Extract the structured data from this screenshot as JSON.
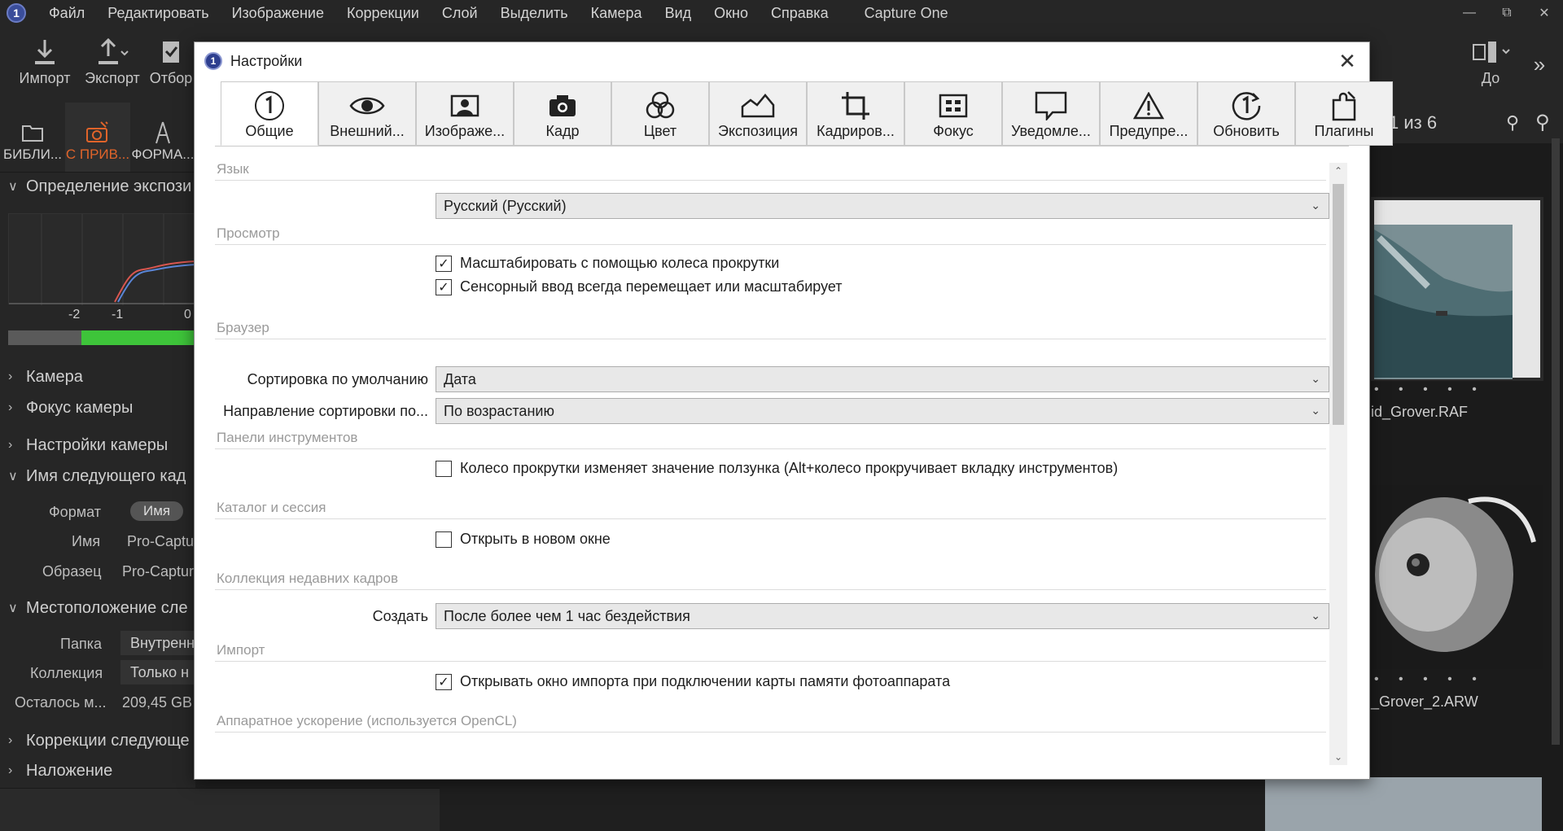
{
  "menubar": {
    "items": [
      "Файл",
      "Редактировать",
      "Изображение",
      "Коррекции",
      "Слой",
      "Выделить",
      "Камера",
      "Вид",
      "Окно",
      "Справка"
    ],
    "app_title": "Capture One",
    "logo": "1"
  },
  "toolbar": {
    "import_label": "Импорт",
    "export_label": "Экспорт",
    "select_label": "Отбор",
    "before_label": "До"
  },
  "left_tabs": [
    {
      "label": "БИБЛИ...",
      "icon": "folder-icon"
    },
    {
      "label": "С ПРИВ...",
      "icon": "camera-tether-icon"
    },
    {
      "label": "ФОРМА...",
      "icon": "compass-icon"
    }
  ],
  "left_panel": {
    "exposure_section": "Определение экспози",
    "scale": [
      "-2",
      "-1",
      "0"
    ],
    "camera": "Камера",
    "camera_focus": "Фокус камеры",
    "camera_settings": "Настройки камеры",
    "next_capture_name": "Имя следующего кад",
    "format_label": "Формат",
    "format_pill": "Имя",
    "name_label": "Имя",
    "name_value": "Pro-Captu",
    "sample_label": "Образец",
    "sample_value": "Pro-Captur",
    "location_section": "Местоположение сле",
    "folder_label": "Папка",
    "folder_value": "Внутренн",
    "collection_label": "Коллекция",
    "collection_value": "Только н",
    "remaining_label": "Осталось м...",
    "remaining_value": "209,45 GB",
    "next_adjustments": "Коррекции следующе",
    "overlay": "Наложение"
  },
  "browser": {
    "counter": "1 из 6",
    "files": [
      "id_Grover.RAF",
      "_Grover_2.ARW"
    ]
  },
  "dialog": {
    "title": "Настройки",
    "tabs": [
      {
        "label": "Общие",
        "icon": "general-icon",
        "active": true
      },
      {
        "label": "Внешний...",
        "icon": "eye-icon",
        "active": false
      },
      {
        "label": "Изображе...",
        "icon": "image-icon",
        "active": false
      },
      {
        "label": "Кадр",
        "icon": "camera-icon",
        "active": false
      },
      {
        "label": "Цвет",
        "icon": "color-circles-icon",
        "active": false
      },
      {
        "label": "Экспозиция",
        "icon": "exposure-icon",
        "active": false
      },
      {
        "label": "Кадриров...",
        "icon": "crop-icon",
        "active": false
      },
      {
        "label": "Фокус",
        "icon": "focus-icon",
        "active": false
      },
      {
        "label": "Уведомле...",
        "icon": "notification-icon",
        "active": false
      },
      {
        "label": "Предупре...",
        "icon": "warning-icon",
        "active": false
      },
      {
        "label": "Обновить",
        "icon": "update-icon",
        "active": false
      },
      {
        "label": "Плагины",
        "icon": "plugin-icon",
        "active": false
      }
    ],
    "sections": {
      "language": {
        "heading": "Язык",
        "value": "Русский (Русский)"
      },
      "view": {
        "heading": "Просмотр",
        "scroll_zoom": {
          "label": "Масштабировать с помощью колеса прокрутки",
          "checked": true
        },
        "touch_input": {
          "label": "Сенсорный ввод всегда перемещает или масштабирует",
          "checked": true
        }
      },
      "browser": {
        "heading": "Браузер",
        "sort_label": "Сортировка по умолчанию",
        "sort_value": "Дата",
        "direction_label": "Направление сортировки по...",
        "direction_value": "По возрастанию"
      },
      "tools": {
        "heading": "Панели инструментов",
        "scroll_slider": {
          "label": "Колесо прокрутки изменяет значение ползунка (Alt+колесо прокручивает вкладку инструментов)",
          "checked": false
        }
      },
      "catalog": {
        "heading": "Каталог и сессия",
        "new_window": {
          "label": "Открыть в новом окне",
          "checked": false
        }
      },
      "recent": {
        "heading": "Коллекция недавних кадров",
        "create_label": "Создать",
        "create_value": "После более чем 1 час бездействия"
      },
      "import": {
        "heading": "Импорт",
        "open_import": {
          "label": "Открывать окно импорта при подключении карты памяти фотоаппарата",
          "checked": true
        }
      },
      "hardware": {
        "heading": "Аппаратное ускорение (используется OpenCL)"
      }
    }
  }
}
